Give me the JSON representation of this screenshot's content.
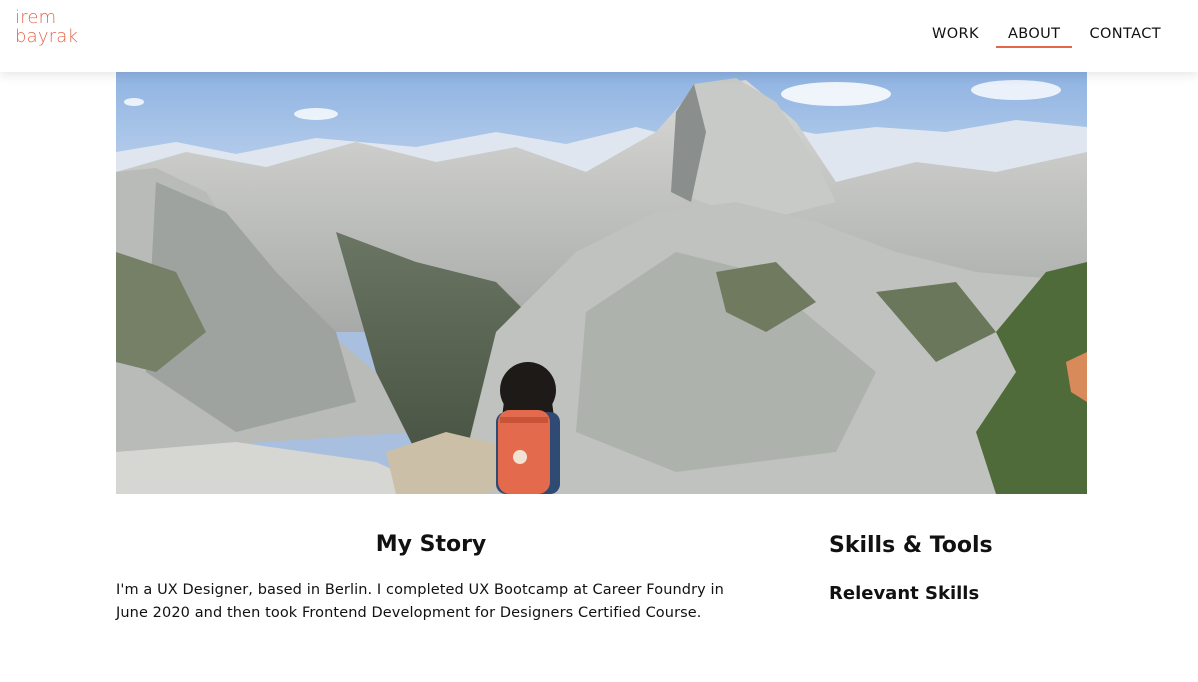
{
  "logo": {
    "line1": "irem",
    "line2": "bayrak"
  },
  "nav": {
    "items": [
      {
        "label": "WORK",
        "active": false
      },
      {
        "label": "ABOUT",
        "active": true
      },
      {
        "label": "CONTACT",
        "active": false
      }
    ]
  },
  "hero": {
    "image_subject": "mountain landscape with hiker wearing orange backpack"
  },
  "story": {
    "title": "My Story",
    "body": "I'm a UX Designer, based in Berlin. I completed UX Bootcamp at Career Foundry in June 2020 and then took Frontend Development for Designers Certified Course."
  },
  "skills": {
    "title": "Skills & Tools",
    "subtitle": "Relevant Skills"
  },
  "colors": {
    "accent": "#e4674d",
    "text": "#111111",
    "background": "#ffffff"
  }
}
